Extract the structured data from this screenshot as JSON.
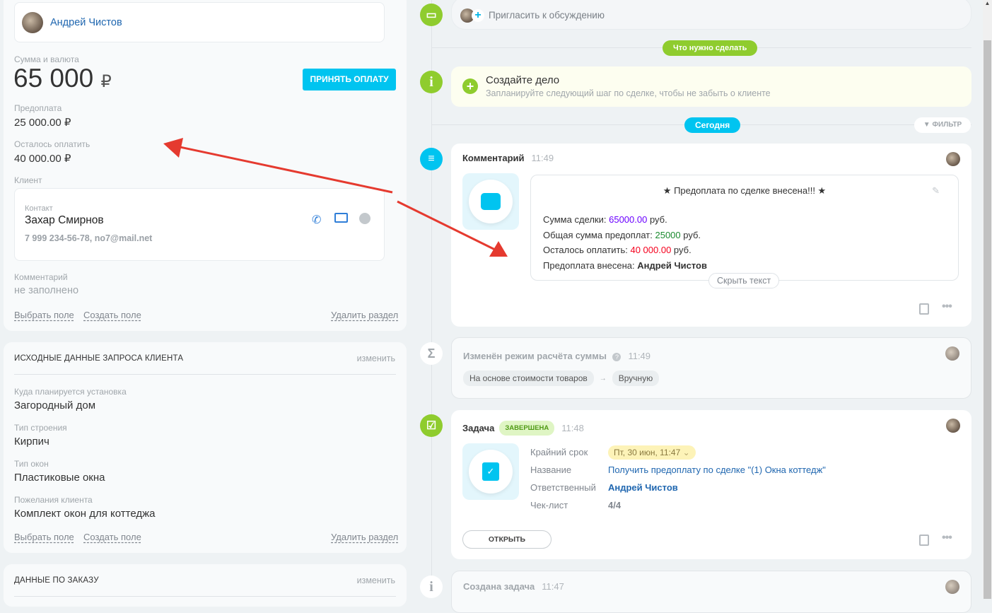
{
  "left": {
    "responsible": "Андрей Чистов",
    "sum_label": "Сумма и валюта",
    "sum_value": "65 000",
    "currency": "₽",
    "accept_button": "ПРИНЯТЬ ОПЛАТУ",
    "prepay_label": "Предоплата",
    "prepay_value": "25 000.00 ₽",
    "remaining_label": "Осталось оплатить",
    "remaining_value": "40 000.00 ₽",
    "client_label": "Клиент",
    "contact_label": "Контакт",
    "contact_name": "Захар Смирнов",
    "contact_details": "7 999 234-56-78, no7@mail.net",
    "comment_label": "Комментарий",
    "comment_value": "не заполнено",
    "select_field": "Выбрать поле",
    "create_field": "Создать поле",
    "delete_section": "Удалить раздел",
    "section2": {
      "title": "ИСХОДНЫЕ ДАННЫЕ ЗАПРОСА КЛИЕНТА",
      "change": "изменить",
      "fields": [
        {
          "label": "Куда планируется установка",
          "value": "Загородный дом"
        },
        {
          "label": "Тип строения",
          "value": "Кирпич"
        },
        {
          "label": "Тип окон",
          "value": "Пластиковые окна"
        },
        {
          "label": "Пожелания клиента",
          "value": "Комплект окон для коттеджа"
        }
      ]
    },
    "section3": {
      "title": "ДАННЫЕ ПО ЗАКАЗУ",
      "change": "изменить"
    }
  },
  "timeline": {
    "invite": "Пригласить к обсуждению",
    "todo_pill": "Что нужно сделать",
    "create_title": "Создайте дело",
    "create_sub": "Запланируйте следующий шаг по сделке, чтобы не забыть о клиенте",
    "today_pill": "Сегодня",
    "filter": "ФИЛЬТР",
    "comment": {
      "title": "Комментарий",
      "time": "11:49",
      "heading": "★ Предоплата по сделке внесена!!! ★",
      "l1": "Сумма сделки: ",
      "l1v": "65000.00",
      "l2": "Общая сумма предоплат: ",
      "l2v": "25000",
      "l3": "Осталось оплатить: ",
      "l3v": "40 000.00",
      "unit": " руб.",
      "l4": "Предоплата внесена: ",
      "l4v": "Андрей Чистов",
      "hide": "Скрыть текст"
    },
    "mode": {
      "title": "Изменён режим расчёта суммы",
      "time": "11:49",
      "from": "На основе стоимости товаров",
      "arrow": "→",
      "to": "Вручную"
    },
    "task": {
      "title": "Задача",
      "status": "ЗАВЕРШЕНА",
      "time": "11:48",
      "deadline_label": "Крайний срок",
      "deadline": "Пт, 30 июн, 11:47",
      "name_label": "Название",
      "name": "Получить предоплату по сделке \"(1) Окна коттедж\"",
      "resp_label": "Ответственный",
      "resp": "Андрей Чистов",
      "check_label": "Чек-лист",
      "check": "4/4",
      "open": "ОТКРЫТЬ"
    },
    "created": {
      "title": "Создана задача",
      "time": "11:47"
    }
  },
  "colors": {
    "accent": "#00c4f0",
    "green": "#8fcc2e",
    "purple": "#6a00ff",
    "dgreen": "#1a8a2e",
    "red": "#f5001d",
    "arrow": "#e53a2f"
  }
}
